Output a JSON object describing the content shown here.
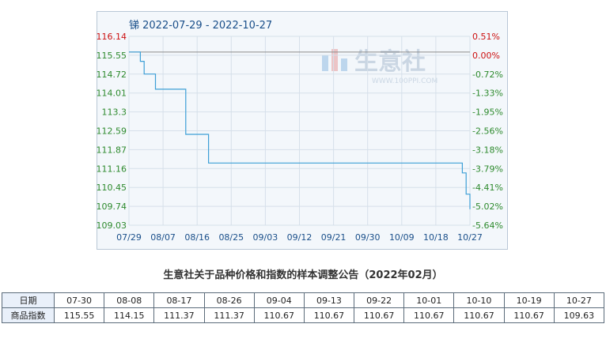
{
  "colors": {
    "line": "#3d9fd6",
    "left_axis": "#2d8a2d",
    "right_axis": "#cc1111",
    "title": "#1a4f8a",
    "frame": "#b9c7d6"
  },
  "chart_data": {
    "type": "line",
    "title": "锑 2022-07-29 - 2022-10-27",
    "x": [
      "07/29",
      "07/30",
      "07/31",
      "08/01",
      "08/02",
      "08/03",
      "08/04",
      "08/05",
      "08/06",
      "08/07",
      "08/08",
      "08/09",
      "08/10",
      "08/11",
      "08/12",
      "08/13",
      "08/14",
      "08/15",
      "08/16",
      "08/17",
      "08/18",
      "08/19",
      "08/20",
      "08/21",
      "08/22",
      "08/23",
      "08/24",
      "08/25",
      "08/26",
      "08/27",
      "08/28",
      "08/29",
      "08/30",
      "08/31",
      "09/01",
      "09/02",
      "09/03",
      "09/04",
      "09/05",
      "09/06",
      "09/07",
      "09/08",
      "09/09",
      "09/10",
      "09/11",
      "09/12",
      "09/13",
      "09/14",
      "09/15",
      "09/16",
      "09/17",
      "09/18",
      "09/19",
      "09/20",
      "09/21",
      "09/22",
      "09/23",
      "09/24",
      "09/25",
      "09/26",
      "09/27",
      "09/28",
      "09/29",
      "09/30",
      "10/01",
      "10/02",
      "10/03",
      "10/04",
      "10/05",
      "10/06",
      "10/07",
      "10/08",
      "10/09",
      "10/10",
      "10/11",
      "10/12",
      "10/13",
      "10/14",
      "10/15",
      "10/16",
      "10/17",
      "10/18",
      "10/19",
      "10/20",
      "10/21",
      "10/22",
      "10/23",
      "10/24",
      "10/25",
      "10/26",
      "10/27"
    ],
    "series": [
      {
        "values": [
          115.55,
          115.55,
          115.55,
          115.2,
          114.72,
          114.72,
          114.72,
          114.15,
          114.15,
          114.15,
          114.15,
          114.15,
          114.15,
          114.15,
          114.15,
          112.45,
          112.45,
          112.45,
          112.45,
          112.45,
          112.45,
          111.37,
          111.37,
          111.37,
          111.37,
          111.37,
          111.37,
          111.37,
          111.37,
          111.37,
          111.37,
          111.37,
          111.37,
          111.37,
          111.37,
          111.37,
          111.37,
          111.37,
          111.37,
          111.37,
          111.37,
          111.37,
          111.37,
          111.37,
          111.37,
          111.37,
          111.37,
          111.37,
          111.37,
          111.37,
          111.37,
          111.37,
          111.37,
          111.37,
          111.37,
          111.37,
          111.37,
          111.37,
          111.37,
          111.37,
          111.37,
          111.37,
          111.37,
          111.37,
          111.37,
          111.37,
          111.37,
          111.37,
          111.37,
          111.37,
          111.37,
          111.37,
          111.37,
          111.37,
          111.37,
          111.37,
          111.37,
          111.37,
          111.37,
          111.37,
          111.37,
          111.37,
          111.37,
          111.37,
          111.37,
          111.37,
          111.37,
          111.37,
          111.0,
          110.2,
          109.63
        ]
      }
    ],
    "x_ticks": [
      "07/29",
      "08/07",
      "08/16",
      "08/25",
      "09/03",
      "09/12",
      "09/21",
      "09/30",
      "10/09",
      "10/18",
      "10/27"
    ],
    "y_ticks_left": [
      "116.14",
      "115.55",
      "114.72",
      "114.01",
      "113.3",
      "112.59",
      "111.87",
      "111.16",
      "110.45",
      "109.74",
      "109.03"
    ],
    "y_ticks_right": [
      "0.51%",
      "0.00%",
      "-0.72%",
      "-1.33%",
      "-1.95%",
      "-2.56%",
      "-3.18%",
      "-3.79%",
      "-4.41%",
      "-5.02%",
      "-5.64%"
    ],
    "ylim": [
      109.03,
      116.14
    ],
    "reference_line": 115.55,
    "grid": true
  },
  "watermark": {
    "brand": "生意社",
    "url": "WWW.100PPI.COM"
  },
  "note": "生意社关于品种价格和指数的样本调整公告（2022年02月）",
  "table": {
    "row_headers": [
      "日期",
      "商品指数"
    ],
    "dates": [
      "07-30",
      "08-08",
      "08-17",
      "08-26",
      "09-04",
      "09-13",
      "09-22",
      "10-01",
      "10-10",
      "10-19",
      "10-27"
    ],
    "values": [
      "115.55",
      "114.15",
      "111.37",
      "111.37",
      "110.67",
      "110.67",
      "110.67",
      "110.67",
      "110.67",
      "110.67",
      "109.63"
    ]
  }
}
